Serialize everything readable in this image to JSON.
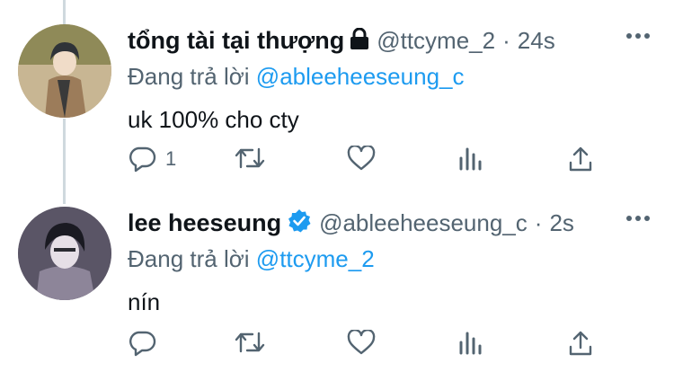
{
  "tweets": [
    {
      "name": "tổng tài tại thượng",
      "handle": "@ttcyme_2",
      "separator": "·",
      "time": "24s",
      "replying_prefix": "Đang trả lời",
      "replying_to": "@ableeheeseung_c",
      "text": "uk 100% cho cty",
      "reply_count": "1",
      "badge_icon": "lock-icon"
    },
    {
      "name": "lee heeseung",
      "handle": "@ableeheeseung_c",
      "separator": "·",
      "time": "2s",
      "replying_prefix": "Đang trả lời",
      "replying_to": "@ttcyme_2",
      "text": "nín",
      "reply_count": "",
      "badge_icon": "verified-icon"
    }
  ],
  "colors": {
    "link": "#1d9bf0",
    "secondary": "#536471",
    "verified": "#1d9bf0",
    "thread_line": "#cfd9de"
  }
}
